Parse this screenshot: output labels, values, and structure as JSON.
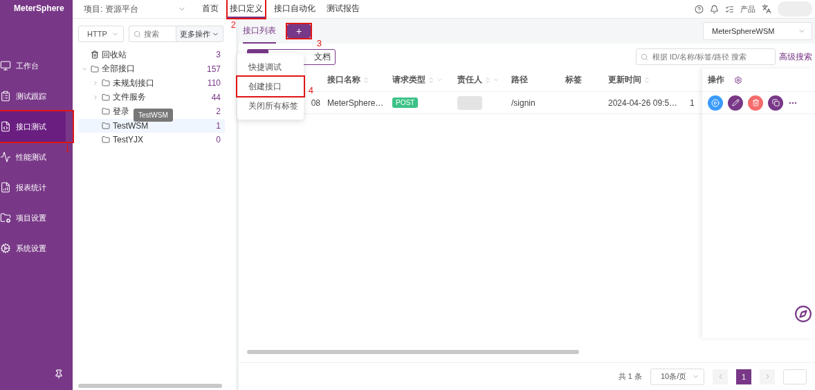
{
  "brand": "MeterSphere",
  "sidebar": [
    {
      "label": "工作台",
      "selected": false
    },
    {
      "label": "测试跟踪",
      "selected": false
    },
    {
      "label": "接口测试",
      "selected": true,
      "annotation": "1"
    },
    {
      "label": "性能测试",
      "selected": false
    },
    {
      "label": "报表统计",
      "selected": false
    },
    {
      "label": "项目设置",
      "selected": false
    },
    {
      "label": "系统设置",
      "selected": false
    }
  ],
  "header": {
    "project": "项目: 资源平台",
    "nav": [
      {
        "label": "首页",
        "selected": false
      },
      {
        "label": "接口定义",
        "selected": true,
        "annotation": "2"
      },
      {
        "label": "接口自动化",
        "selected": false
      },
      {
        "label": "测试报告",
        "selected": false
      }
    ],
    "product": "产品"
  },
  "tree": {
    "protocol": "HTTP",
    "search_placeholder": "搜索",
    "more": "更多操作",
    "trash": {
      "label": "回收站",
      "count": "3"
    },
    "nodes": [
      {
        "label": "全部接口",
        "count": "157",
        "expandable": true,
        "expanded": true,
        "selected": false,
        "children": [
          {
            "label": "未规划接口",
            "count": "110",
            "expandable": true,
            "expanded": false,
            "selected": false
          },
          {
            "label": "文件服务",
            "count": "44",
            "expandable": true,
            "expanded": false,
            "selected": false
          },
          {
            "label": "登录",
            "count": "2",
            "expandable": false,
            "expanded": false,
            "selected": false
          },
          {
            "label": "TestWSM",
            "count": "1",
            "expandable": false,
            "expanded": false,
            "selected": true
          },
          {
            "label": "TestYJX",
            "count": "0",
            "expandable": false,
            "expanded": false,
            "selected": false
          }
        ]
      }
    ],
    "tooltip": "TestWSM"
  },
  "main": {
    "tabs": [
      {
        "label": "接口列表",
        "selected": true
      }
    ],
    "add_button": {
      "label": "+",
      "annotation": "3"
    },
    "environment": "MeterSphereWSM",
    "doc_view": "文档",
    "search_placeholder": "根据 ID/名称/标签/路径 搜索",
    "advanced_search": "高级搜索",
    "columns": [
      {
        "label": "接口名称",
        "sortable": true,
        "filter": false
      },
      {
        "label": "请求类型",
        "sortable": true,
        "filter": true
      },
      {
        "label": "责任人",
        "sortable": true,
        "filter": true
      },
      {
        "label": "路径",
        "sortable": false,
        "filter": false
      },
      {
        "label": "标签",
        "sortable": false,
        "filter": false
      },
      {
        "label": "更新时间",
        "sortable": true,
        "filter": false
      }
    ],
    "ops_header": "操作",
    "rows": [
      {
        "column_1": "08",
        "name": "MeterSphere…",
        "method": "POST",
        "path": "/signin",
        "updated": "2024-04-26 09:5…",
        "column_8": "1"
      }
    ],
    "menu": [
      {
        "label": "快捷调试"
      },
      {
        "label": "创建接口",
        "annotation": "4"
      },
      {
        "label": "关闭所有标签"
      }
    ],
    "pagination": {
      "total": "共 1 条",
      "page_size": "10条/页",
      "pages": [
        {
          "label": "1",
          "selected": true
        }
      ]
    }
  }
}
